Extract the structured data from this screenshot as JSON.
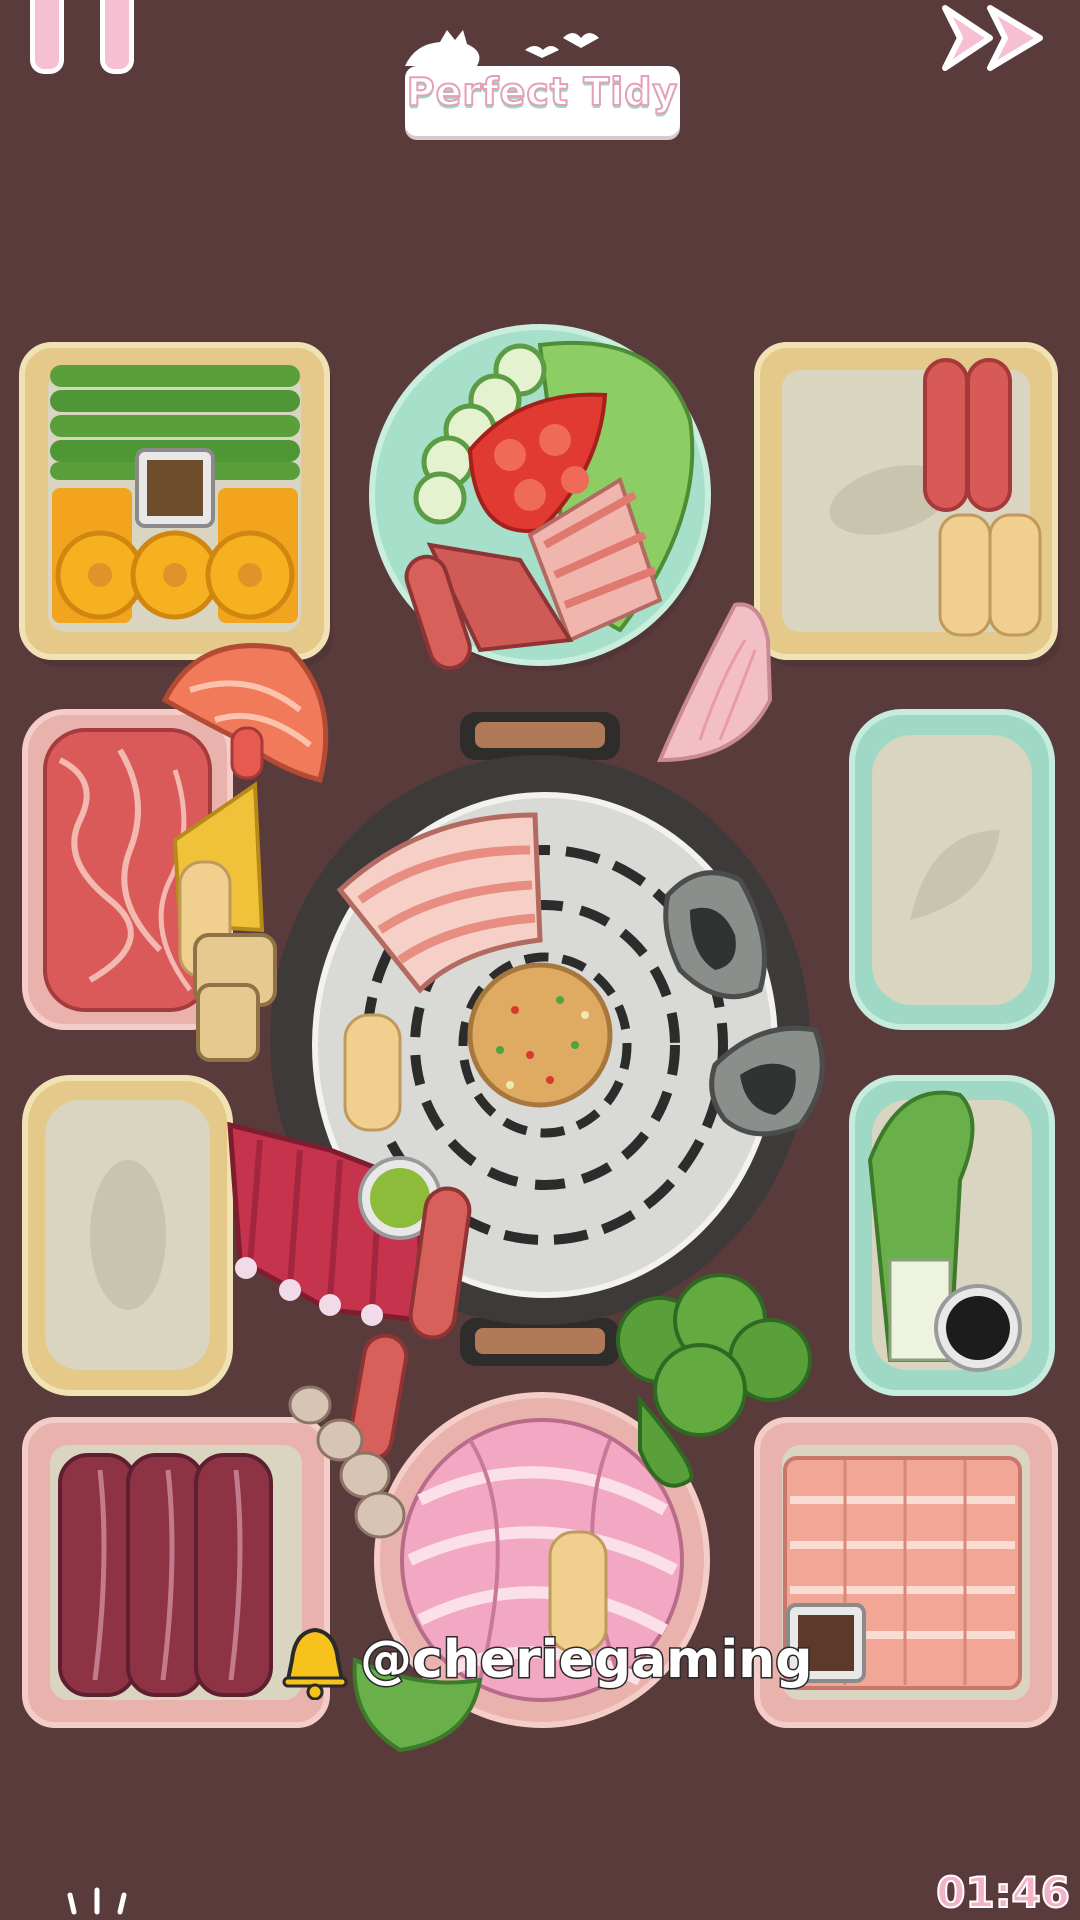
{
  "game": {
    "title": "Perfect Tidy",
    "timer": "01:46",
    "watermark": "@cheriegaming"
  },
  "hud": {
    "pause_icon": "pause-icon",
    "fast_forward_icon": "fast-forward-icon",
    "bell_icon": "bell-icon"
  },
  "colors": {
    "background": "#5a3b3c",
    "tray_yellow": "#e4c98b",
    "tray_pink": "#e9b2ad",
    "tray_mint": "#9fd9c6",
    "tray_inner": "#d9d5c0",
    "grill_dark": "#3e3a3a",
    "grill_plate": "#d9d9d6",
    "accent_pink": "#f3b2c8"
  },
  "trays": [
    {
      "name": "tray-top-left",
      "contents": [
        "green-beans",
        "corn-slices",
        "sauce-cup"
      ]
    },
    {
      "name": "tray-top-right",
      "contents": [
        "sausages",
        "rice-cakes"
      ]
    },
    {
      "name": "tray-mid-left",
      "contents": [
        "marbled-beef"
      ]
    },
    {
      "name": "tray-mid-right",
      "contents": []
    },
    {
      "name": "tray-lower-left",
      "contents": []
    },
    {
      "name": "tray-lower-right",
      "contents": [
        "green-onions",
        "soy-sauce"
      ]
    },
    {
      "name": "tray-bottom-left",
      "contents": [
        "beef-slices"
      ]
    },
    {
      "name": "tray-bottom-right",
      "contents": [
        "pork-belly-slices",
        "sauce-cup"
      ]
    }
  ],
  "plates": [
    {
      "name": "plate-top-center",
      "contents": [
        "lettuce",
        "cucumber",
        "tomato",
        "bacon",
        "sausage"
      ]
    },
    {
      "name": "plate-bottom-center",
      "contents": [
        "pork-rolls",
        "rice-cake",
        "green-pepper"
      ]
    }
  ],
  "loose_items": [
    "salmon-slice",
    "pineapple",
    "fish-cakes",
    "enoki-mushroom",
    "pork-ribs",
    "sausage",
    "shrimp",
    "broccoli",
    "wasabi",
    "rice-cake"
  ],
  "grill_items": [
    "pork-belly",
    "fried-rice",
    "oyster",
    "oyster",
    "rice-cake"
  ]
}
